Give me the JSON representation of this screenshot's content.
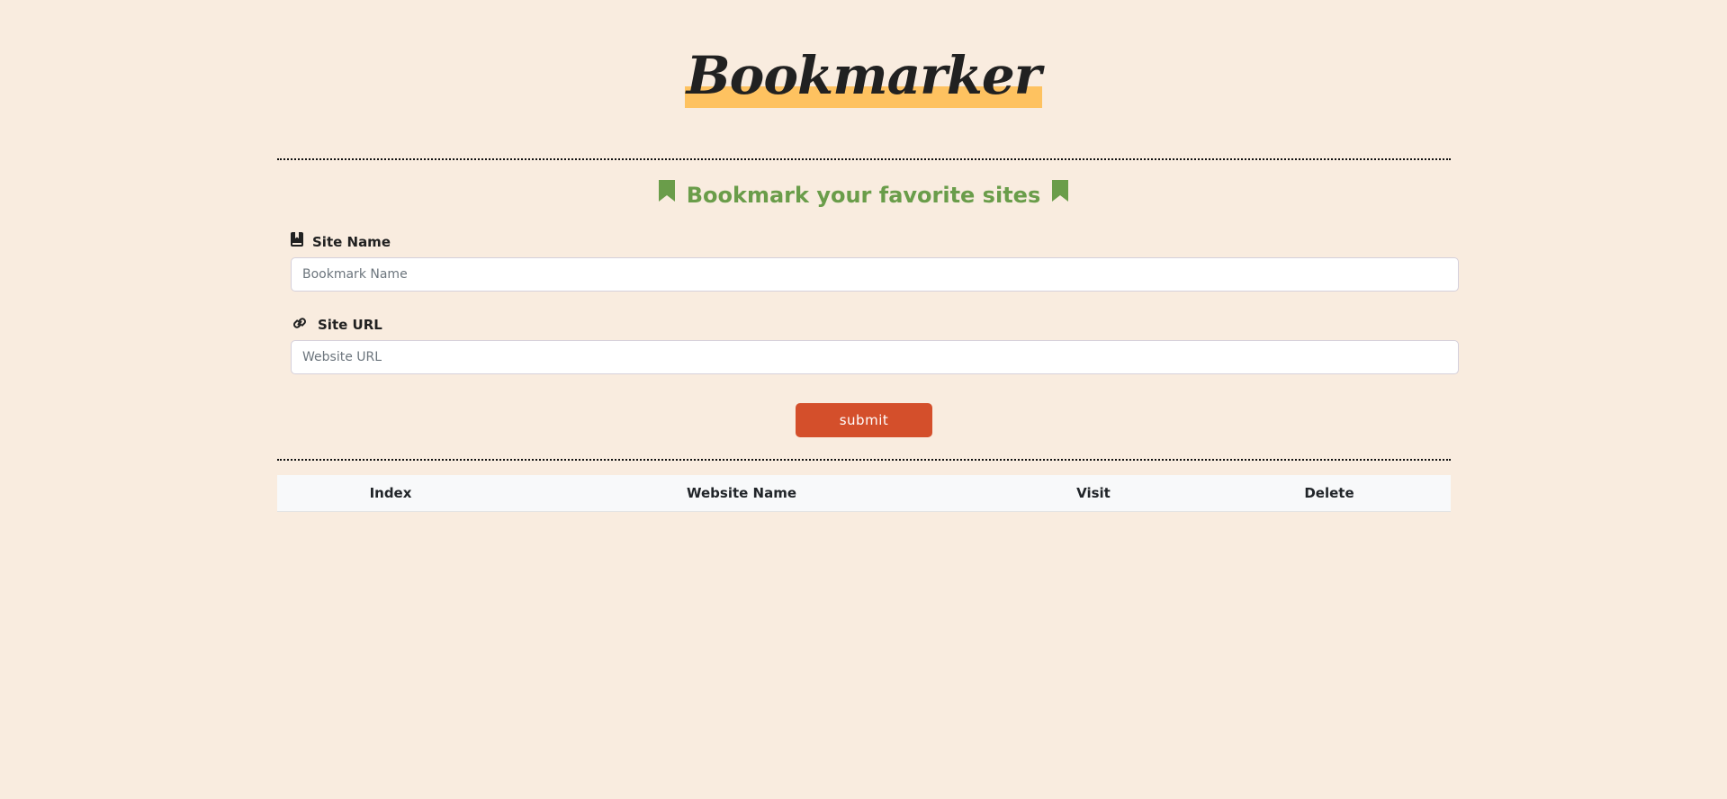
{
  "app": {
    "logo_text": "Bookmarker"
  },
  "form": {
    "headline": "Bookmark your favorite sites",
    "site_name": {
      "label": "Site Name",
      "placeholder": "Bookmark Name",
      "value": ""
    },
    "site_url": {
      "label": "Site URL",
      "placeholder": "Website URL",
      "value": ""
    },
    "submit_label": "submit"
  },
  "table": {
    "columns": [
      "Index",
      "Website Name",
      "Visit",
      "Delete"
    ],
    "rows": []
  },
  "icons": {
    "headline_left": "bookmark-icon",
    "headline_right": "bookmark-icon",
    "site_name": "book-icon",
    "site_url": "link-icon"
  },
  "colors": {
    "background": "#f9ecdf",
    "logo_highlight": "#fec260",
    "headline": "#6a9d4a",
    "submit_button": "#d44f2b"
  }
}
